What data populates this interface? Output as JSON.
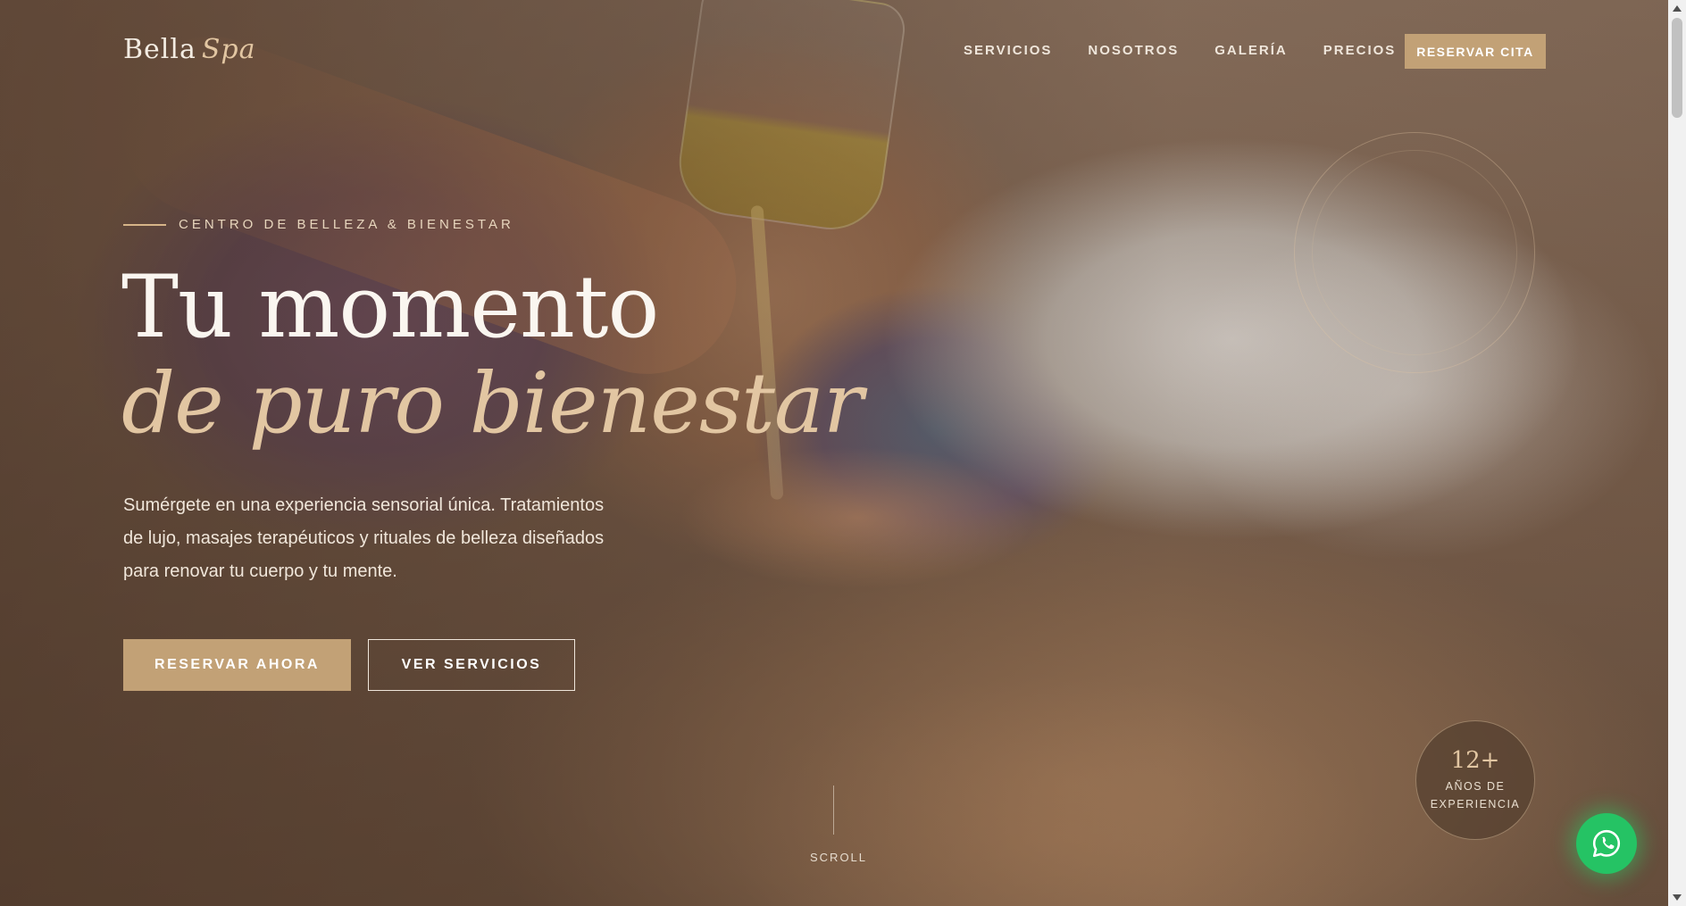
{
  "brand": {
    "name": "Bella",
    "accent": "Spa"
  },
  "nav": {
    "items": [
      {
        "label": "SERVICIOS"
      },
      {
        "label": "NOSOTROS"
      },
      {
        "label": "GALERÍA"
      },
      {
        "label": "PRECIOS"
      }
    ],
    "cta_label": "RESERVAR CITA"
  },
  "hero": {
    "eyebrow": "CENTRO DE BELLEZA & BIENESTAR",
    "title_line1": "Tu momento",
    "title_line2": "de puro bienestar",
    "lead": "Sumérgete en una experiencia sensorial única. Tratamientos de lujo, masajes terapéuticos y rituales de belleza diseñados para renovar tu cuerpo y tu mente.",
    "primary_button": "RESERVAR AHORA",
    "secondary_button": "VER SERVICIOS",
    "scroll_label": "SCROLL"
  },
  "badge": {
    "number": "12+",
    "line1": "AÑOS DE",
    "line2": "EXPERIENCIA"
  },
  "colors": {
    "accent_gold": "#c2a176",
    "title_gold": "#e2c6a2",
    "whatsapp_green": "#25c364"
  },
  "icons": {
    "whatsapp": "whatsapp-icon"
  }
}
